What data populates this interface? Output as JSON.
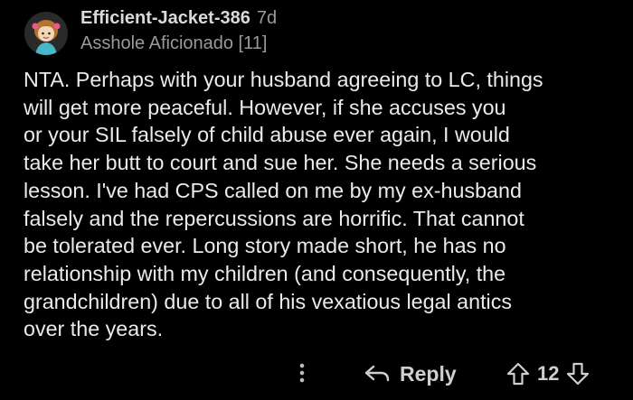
{
  "comment": {
    "author": "Efficient-Jacket-386",
    "age": "7d",
    "flair": "Asshole Aficionado [11]",
    "body_lines": [
      "NTA.  Perhaps with your husband agreeing to LC, things",
      "will get more peaceful.  However, if she accuses you",
      "or your SIL falsely of child abuse ever again, I would",
      "take her butt to court and sue her.  She needs a serious",
      "lesson.  I've had CPS called on me by my ex-husband",
      "falsely and the repercussions are horrific.  That cannot",
      "be tolerated ever.  Long story made short, he has no",
      "relationship with my children (and consequently, the",
      "grandchildren) due to all of his vexatious legal antics",
      "over the years."
    ]
  },
  "actions": {
    "more_icon": "vertical-ellipsis-icon",
    "reply_icon": "reply-arrow-icon",
    "reply_label": "Reply",
    "upvote_icon": "upvote-arrow-icon",
    "vote_count": "12",
    "downvote_icon": "downvote-arrow-icon"
  },
  "colors": {
    "background": "#000000",
    "text": "#eaeaea",
    "muted": "#9a9a9a"
  }
}
